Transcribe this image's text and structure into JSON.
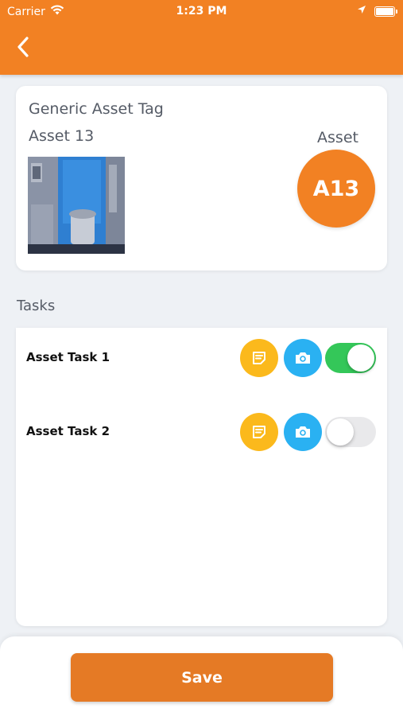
{
  "status_bar": {
    "carrier": "Carrier",
    "time": "1:23 PM"
  },
  "asset": {
    "tag": "Generic Asset Tag",
    "name": "Asset 13",
    "label": "Asset",
    "badge": "A13"
  },
  "tasks": {
    "title": "Tasks",
    "items": [
      {
        "label": "Asset Task 1",
        "completed": true
      },
      {
        "label": "Asset Task 2",
        "completed": false
      }
    ]
  },
  "footer": {
    "save_label": "Save"
  },
  "colors": {
    "header": "#f28123",
    "note_button": "#fbb91c",
    "camera_button": "#2ab1f2",
    "toggle_on": "#34c759",
    "save_button": "#e57a25"
  }
}
